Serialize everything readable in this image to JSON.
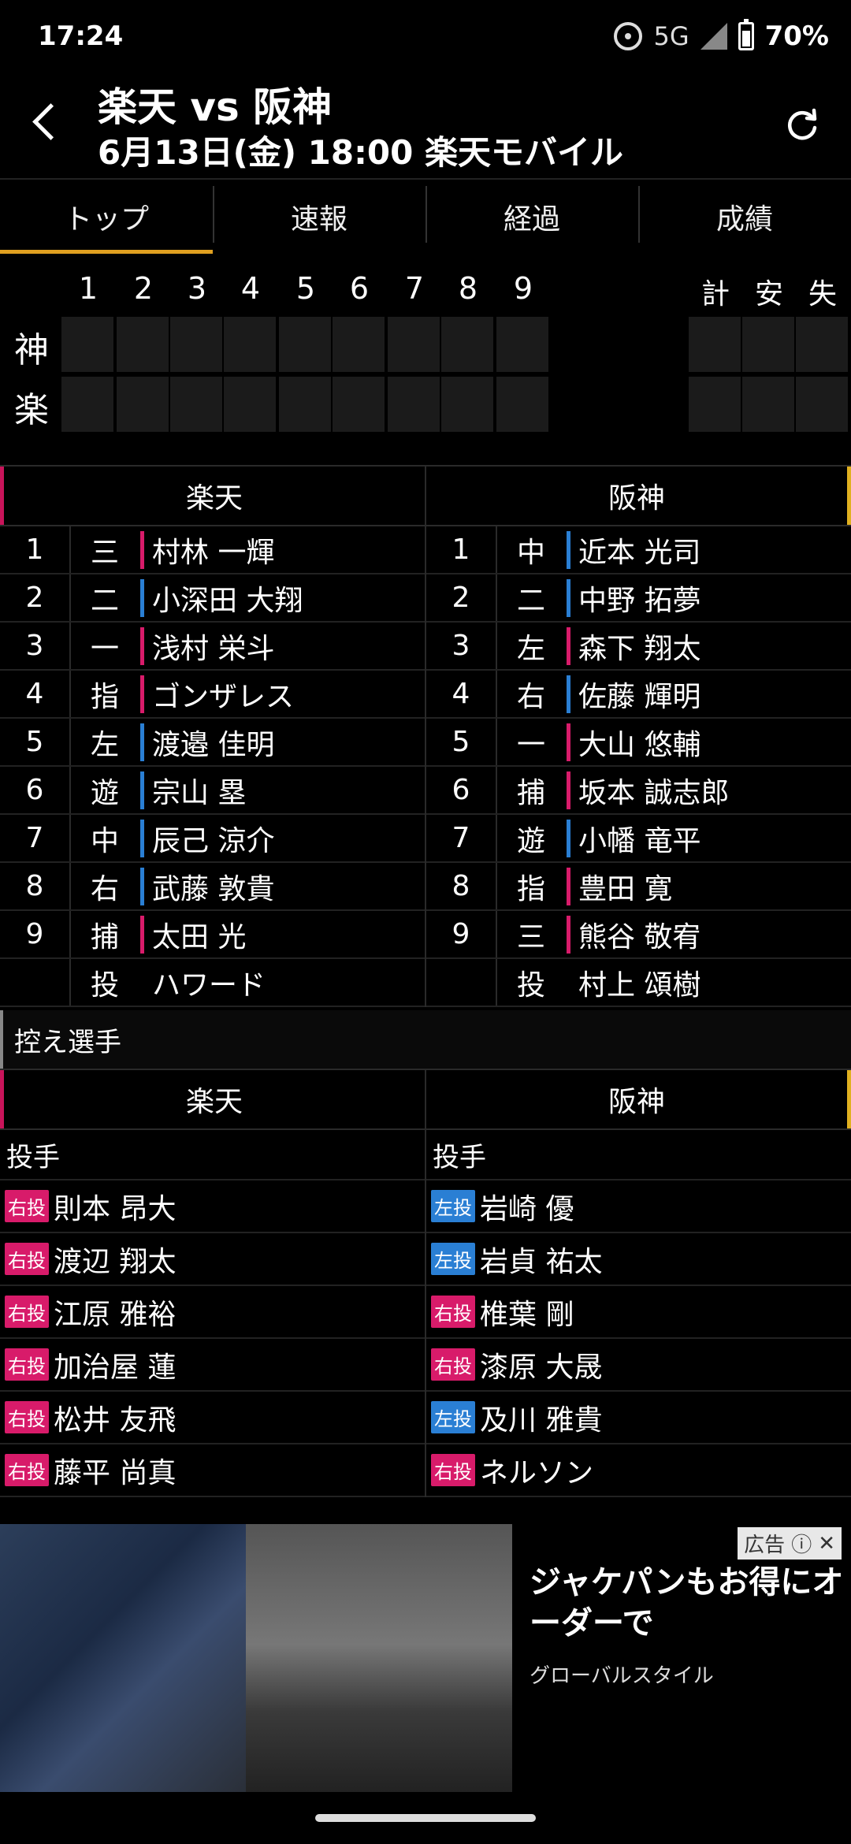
{
  "status": {
    "time": "17:24",
    "network": "5G",
    "battery": "70%"
  },
  "header": {
    "title": "楽天 vs 阪神",
    "subtitle": "6月13日(金) 18:00 楽天モバイル"
  },
  "tabs": [
    {
      "label": "トップ"
    },
    {
      "label": "速報"
    },
    {
      "label": "経過"
    },
    {
      "label": "成績"
    }
  ],
  "scoreboard": {
    "innings": [
      "1",
      "2",
      "3",
      "4",
      "5",
      "6",
      "7",
      "8",
      "9"
    ],
    "totals": [
      "計",
      "安",
      "失"
    ],
    "teams": [
      "神",
      "楽"
    ]
  },
  "lineup": {
    "home_team": "楽天",
    "away_team": "阪神",
    "home": [
      {
        "num": "1",
        "pos": "三",
        "name": "村林 一輝",
        "bar": "#d81b6a"
      },
      {
        "num": "2",
        "pos": "二",
        "name": "小深田 大翔",
        "bar": "#2a7fd4"
      },
      {
        "num": "3",
        "pos": "一",
        "name": "浅村 栄斗",
        "bar": "#d81b6a"
      },
      {
        "num": "4",
        "pos": "指",
        "name": "ゴンザレス",
        "bar": "#d81b6a"
      },
      {
        "num": "5",
        "pos": "左",
        "name": "渡邉 佳明",
        "bar": "#2a7fd4"
      },
      {
        "num": "6",
        "pos": "遊",
        "name": "宗山 塁",
        "bar": "#2a7fd4"
      },
      {
        "num": "7",
        "pos": "中",
        "name": "辰己 涼介",
        "bar": "#2a7fd4"
      },
      {
        "num": "8",
        "pos": "右",
        "name": "武藤 敦貴",
        "bar": "#2a7fd4"
      },
      {
        "num": "9",
        "pos": "捕",
        "name": "太田 光",
        "bar": "#d81b6a"
      },
      {
        "num": "",
        "pos": "投",
        "name": "ハワード",
        "bar": ""
      }
    ],
    "away": [
      {
        "num": "1",
        "pos": "中",
        "name": "近本 光司",
        "bar": "#2a7fd4"
      },
      {
        "num": "2",
        "pos": "二",
        "name": "中野 拓夢",
        "bar": "#2a7fd4"
      },
      {
        "num": "3",
        "pos": "左",
        "name": "森下 翔太",
        "bar": "#d81b6a"
      },
      {
        "num": "4",
        "pos": "右",
        "name": "佐藤 輝明",
        "bar": "#2a7fd4"
      },
      {
        "num": "5",
        "pos": "一",
        "name": "大山 悠輔",
        "bar": "#d81b6a"
      },
      {
        "num": "6",
        "pos": "捕",
        "name": "坂本 誠志郎",
        "bar": "#d81b6a"
      },
      {
        "num": "7",
        "pos": "遊",
        "name": "小幡 竜平",
        "bar": "#2a7fd4"
      },
      {
        "num": "8",
        "pos": "指",
        "name": "豊田 寛",
        "bar": "#d81b6a"
      },
      {
        "num": "9",
        "pos": "三",
        "name": "熊谷 敬宥",
        "bar": "#d81b6a"
      },
      {
        "num": "",
        "pos": "投",
        "name": "村上 頌樹",
        "bar": ""
      }
    ]
  },
  "bench": {
    "title": "控え選手",
    "home_team": "楽天",
    "away_team": "阪神",
    "sub_label": "投手",
    "home": [
      {
        "badge": "右投",
        "type": "R",
        "name": "則本 昂大"
      },
      {
        "badge": "右投",
        "type": "R",
        "name": "渡辺 翔太"
      },
      {
        "badge": "右投",
        "type": "R",
        "name": "江原 雅裕"
      },
      {
        "badge": "右投",
        "type": "R",
        "name": "加治屋 蓮"
      },
      {
        "badge": "右投",
        "type": "R",
        "name": "松井 友飛"
      },
      {
        "badge": "右投",
        "type": "R",
        "name": "藤平 尚真"
      }
    ],
    "away": [
      {
        "badge": "左投",
        "type": "L",
        "name": "岩崎 優"
      },
      {
        "badge": "左投",
        "type": "L",
        "name": "岩貞 祐太"
      },
      {
        "badge": "右投",
        "type": "R",
        "name": "椎葉 剛"
      },
      {
        "badge": "右投",
        "type": "R",
        "name": "漆原 大晟"
      },
      {
        "badge": "左投",
        "type": "L",
        "name": "及川 雅貴"
      },
      {
        "badge": "右投",
        "type": "R",
        "name": "ネルソン"
      }
    ]
  },
  "ad": {
    "label": "広告",
    "headline": "ジャケパンもお得にオーダーで",
    "advertiser": "グローバルスタイル"
  }
}
